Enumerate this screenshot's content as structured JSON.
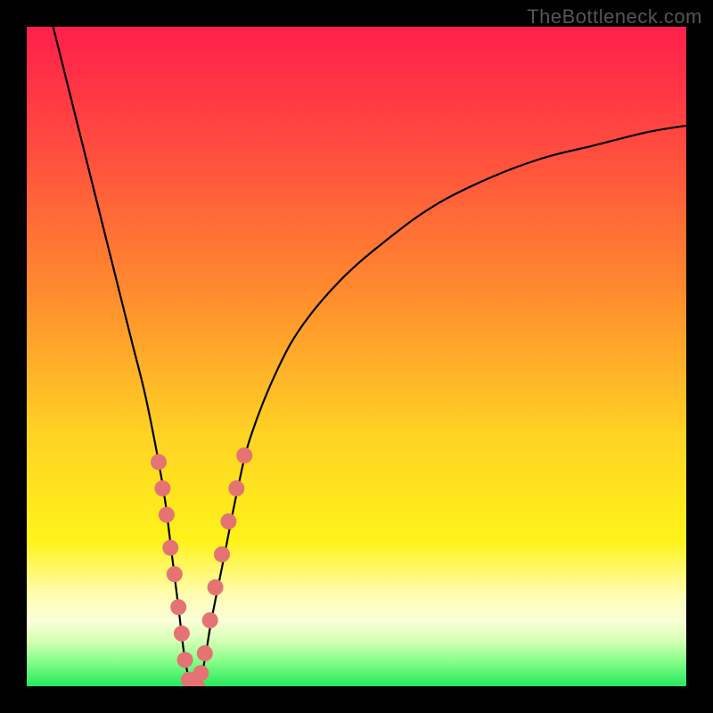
{
  "watermark": "TheBottleneck.com",
  "colors": {
    "frame": "#000000",
    "dot": "#e57373",
    "curve": "#000000",
    "gradient_stops": [
      {
        "pct": 0,
        "color": "#ff1f4b"
      },
      {
        "pct": 18,
        "color": "#ff4b3f"
      },
      {
        "pct": 40,
        "color": "#ff8b2e"
      },
      {
        "pct": 62,
        "color": "#ffd324"
      },
      {
        "pct": 78,
        "color": "#fff31a"
      },
      {
        "pct": 86,
        "color": "#fffcb0"
      },
      {
        "pct": 90,
        "color": "#fcffd8"
      },
      {
        "pct": 93,
        "color": "#d8ffb6"
      },
      {
        "pct": 96,
        "color": "#8cff8c"
      },
      {
        "pct": 100,
        "color": "#26e85c"
      }
    ]
  },
  "chart_data": {
    "type": "line",
    "title": "",
    "xlabel": "",
    "ylabel": "",
    "xlim": [
      0,
      100
    ],
    "ylim": [
      0,
      100
    ],
    "series": [
      {
        "name": "bottleneck-curve",
        "x": [
          4,
          6,
          8,
          10,
          12,
          14,
          16,
          18,
          20,
          21,
          22,
          23,
          24,
          25,
          26,
          27,
          28,
          30,
          32,
          34,
          38,
          42,
          48,
          55,
          62,
          70,
          78,
          86,
          94,
          100
        ],
        "y": [
          100,
          92,
          84,
          76,
          68,
          60,
          52,
          44,
          34,
          28,
          20,
          12,
          4,
          0,
          0,
          4,
          10,
          20,
          30,
          38,
          48,
          55,
          62,
          68,
          73,
          77,
          80,
          82,
          84,
          85
        ]
      }
    ],
    "dots": {
      "name": "highlight-dots",
      "points": [
        {
          "x": 20.0,
          "y": 34
        },
        {
          "x": 20.6,
          "y": 30
        },
        {
          "x": 21.2,
          "y": 26
        },
        {
          "x": 21.8,
          "y": 21
        },
        {
          "x": 22.4,
          "y": 17
        },
        {
          "x": 23.0,
          "y": 12
        },
        {
          "x": 23.5,
          "y": 8
        },
        {
          "x": 24.0,
          "y": 4
        },
        {
          "x": 24.6,
          "y": 1
        },
        {
          "x": 25.2,
          "y": 0
        },
        {
          "x": 25.8,
          "y": 0
        },
        {
          "x": 26.4,
          "y": 2
        },
        {
          "x": 27.0,
          "y": 5
        },
        {
          "x": 27.8,
          "y": 10
        },
        {
          "x": 28.6,
          "y": 15
        },
        {
          "x": 29.6,
          "y": 20
        },
        {
          "x": 30.6,
          "y": 25
        },
        {
          "x": 31.8,
          "y": 30
        },
        {
          "x": 33.0,
          "y": 35
        }
      ]
    }
  }
}
